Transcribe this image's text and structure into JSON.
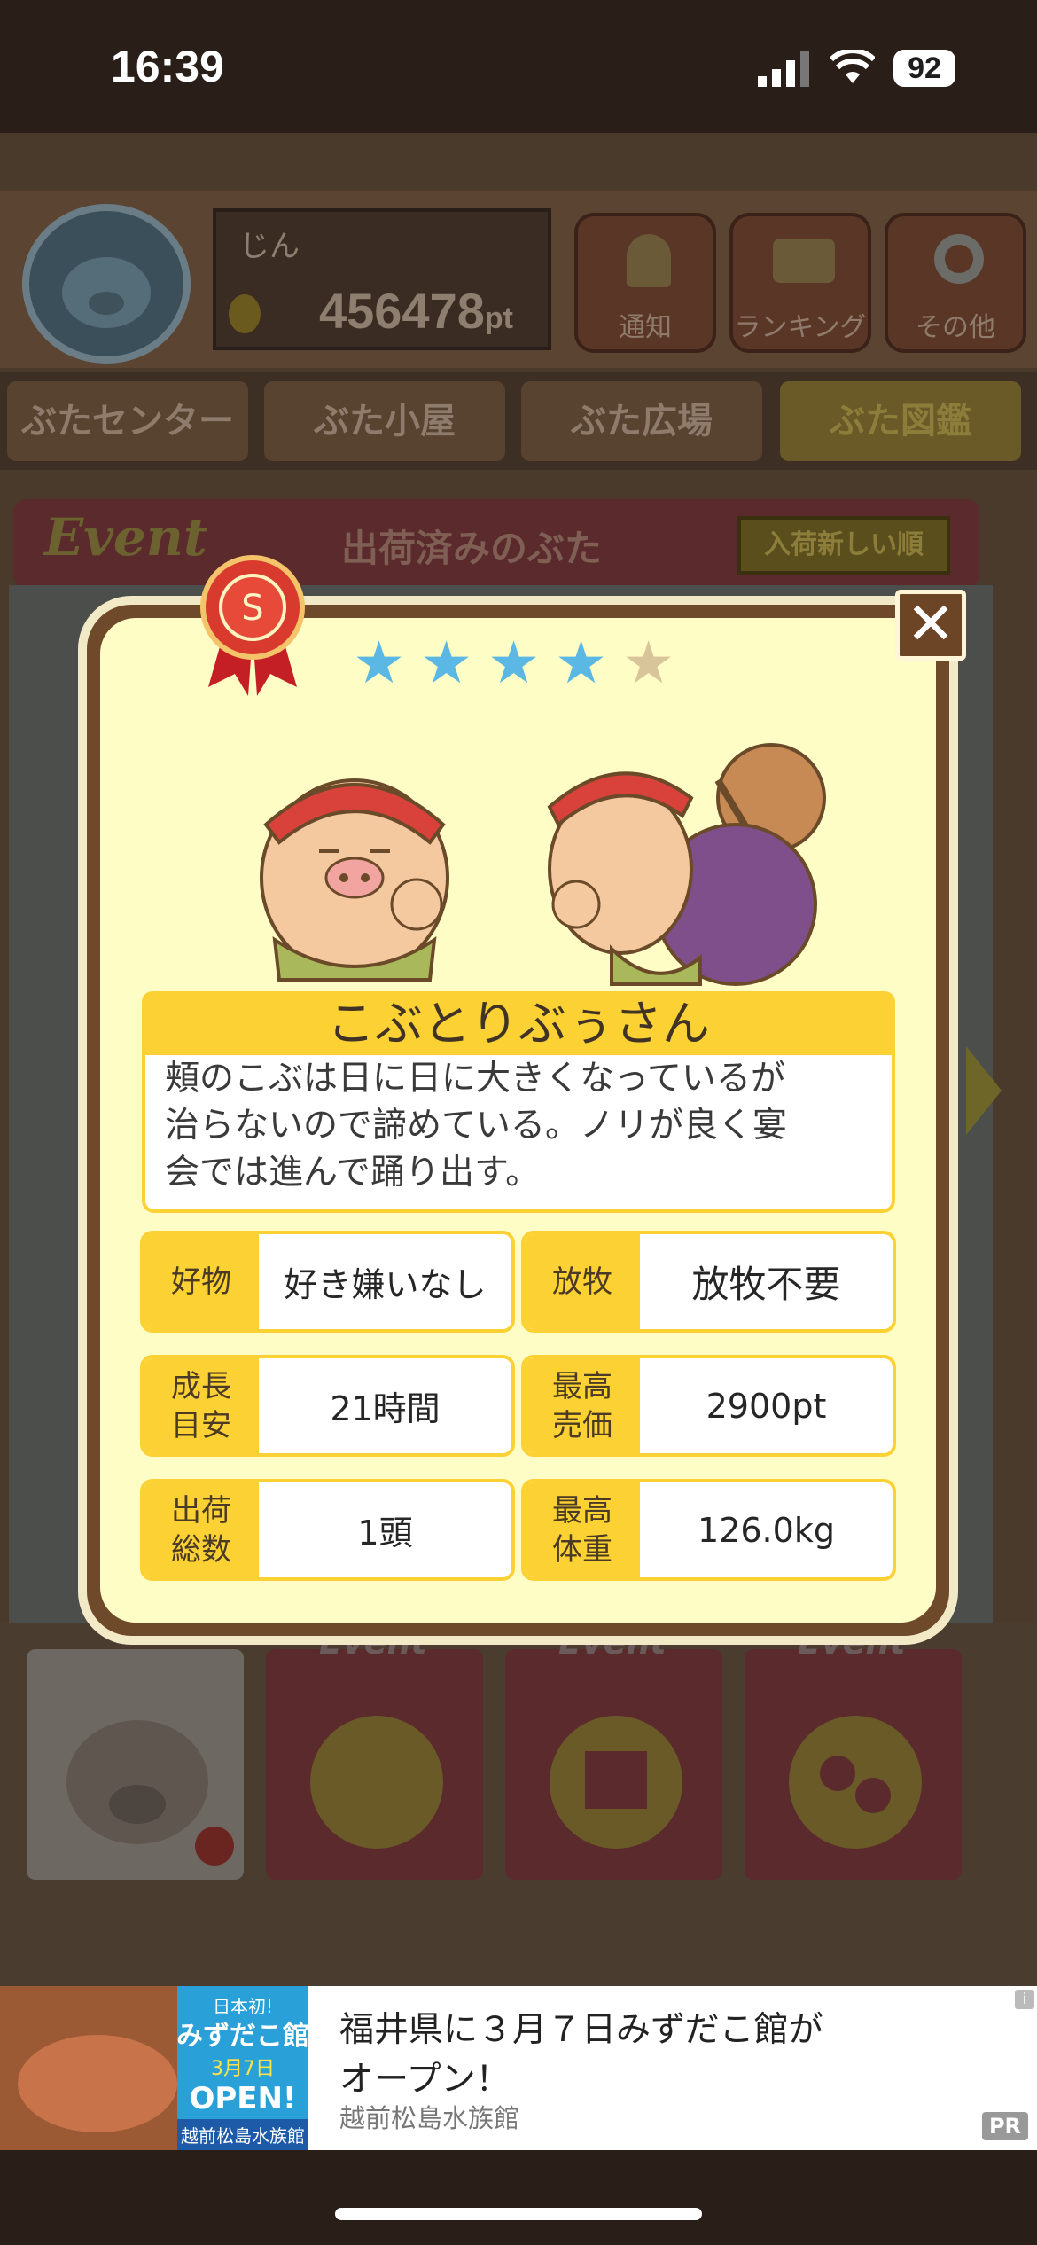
{
  "status_bar": {
    "time": "16:39",
    "battery": "92"
  },
  "header": {
    "player_name": "じん",
    "points": "456478",
    "points_unit": "pt"
  },
  "top_buttons": [
    {
      "label": "通知",
      "icon": "bell-icon"
    },
    {
      "label": "ランキング",
      "icon": "crown-icon"
    },
    {
      "label": "その他",
      "icon": "gear-icon"
    }
  ],
  "tabs": [
    "ぶたセンター",
    "ぶた小屋",
    "ぶた広場",
    "ぶた図鑑"
  ],
  "event_bar": {
    "event_label": "Event",
    "title": "出荷済みのぶた",
    "sort_button": "入荷新しい順"
  },
  "bottom_books": [
    {
      "label": "",
      "icon": "pig-notebook-icon"
    },
    {
      "label": "Event",
      "icon": "laurel-pig-icon"
    },
    {
      "label": "Event",
      "icon": "calendar-icon"
    },
    {
      "label": "Event",
      "icon": "two-pigs-icon"
    }
  ],
  "modal": {
    "rank": "S",
    "stars_filled": 4,
    "stars_total": 5,
    "pig_name": "こぶとりぶぅさん",
    "description": [
      "頬のこぶは日に日に大きくなっているが",
      "治らないので諦めている。ノリが良く宴",
      "会では進んで踊り出す。"
    ],
    "stats": [
      {
        "label": "好物",
        "value": "好き嫌いなし"
      },
      {
        "label": "放牧",
        "value": "放牧不要"
      },
      {
        "label": "成長\n目安",
        "value": "21時間"
      },
      {
        "label": "最高\n売価",
        "value": "2900pt"
      },
      {
        "label": "出荷\n総数",
        "value": "1頭"
      },
      {
        "label": "最高\n体重",
        "value": "126.0kg"
      }
    ],
    "close_label": "✕"
  },
  "ad": {
    "title_line1": "福井県に３月７日みずだこ館が",
    "title_line2": "オープン！",
    "source": "越前松島水族館",
    "pr": "PR",
    "image_text": {
      "top": "日本初!",
      "main": "みずだこ館",
      "date": "3月7日",
      "open": "OPEN!",
      "footer": "越前松島水族館"
    }
  },
  "colors": {
    "modal_bg": "#fffdc6",
    "banner_yellow": "#fbd133",
    "star_blue": "#5bb7e3",
    "star_empty": "#d8c59a",
    "ribbon_red": "#d42b2b"
  }
}
